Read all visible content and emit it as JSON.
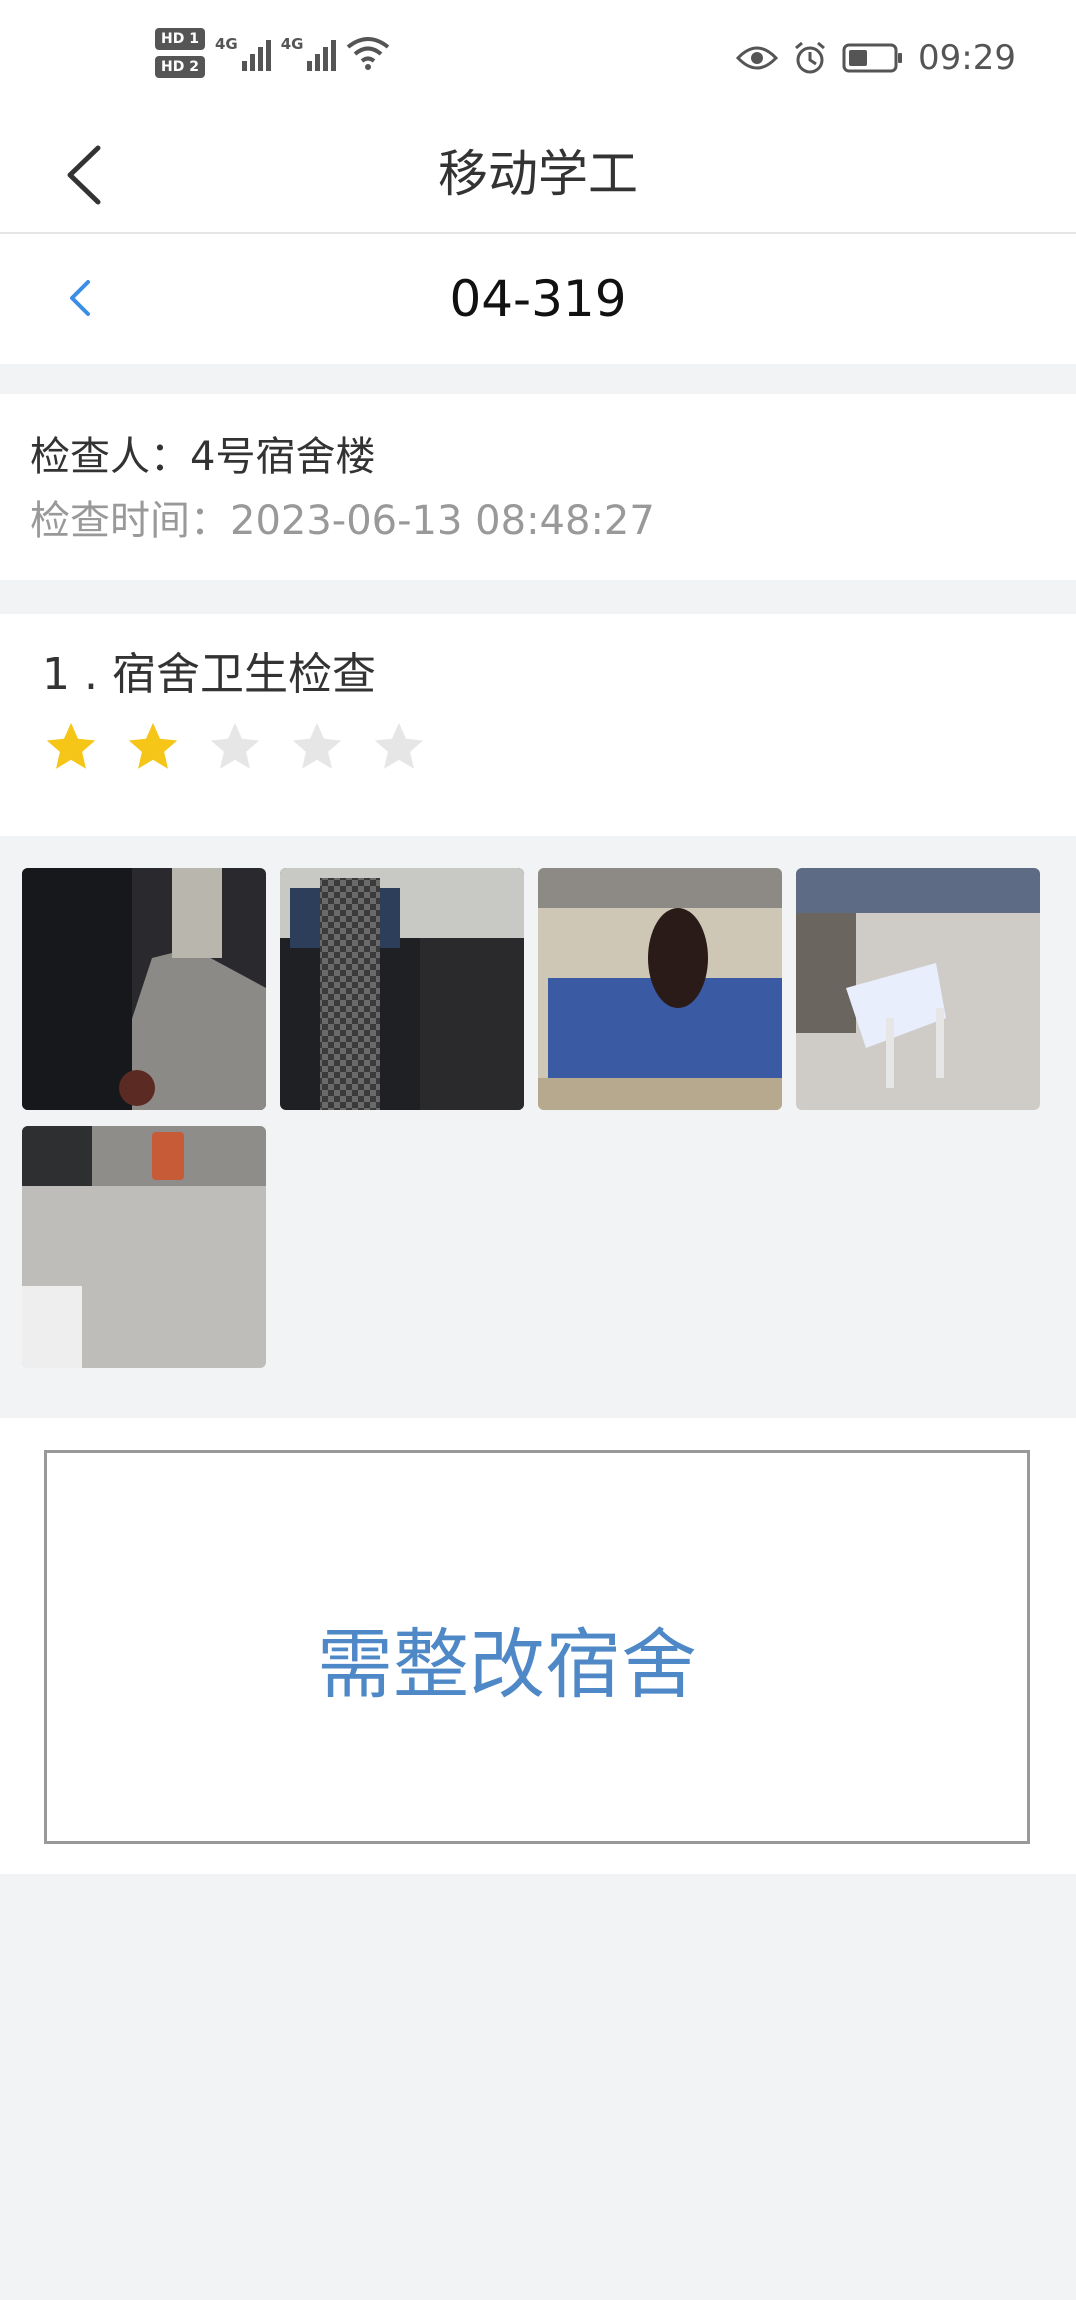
{
  "status_bar": {
    "sim1": "HD 1",
    "sim2": "HD 2",
    "net1": "4G",
    "net2": "4G",
    "time": "09:29"
  },
  "navbar": {
    "title": "移动学工"
  },
  "subbar": {
    "title": "04-319"
  },
  "info": {
    "inspector": "检查人：4号宿舍楼",
    "inspect_time": "检查时间：2023-06-13 08:48:27"
  },
  "item": {
    "title": "1 . 宿舍卫生检查",
    "rating": 2,
    "max_rating": 5,
    "star_color": "#f5c518",
    "star_empty_color": "#e6e6e6"
  },
  "photos": [
    "photo-1",
    "photo-2",
    "photo-3",
    "photo-4",
    "photo-5"
  ],
  "remark": {
    "text": "需整改宿舍",
    "color": "#4f88c6"
  }
}
